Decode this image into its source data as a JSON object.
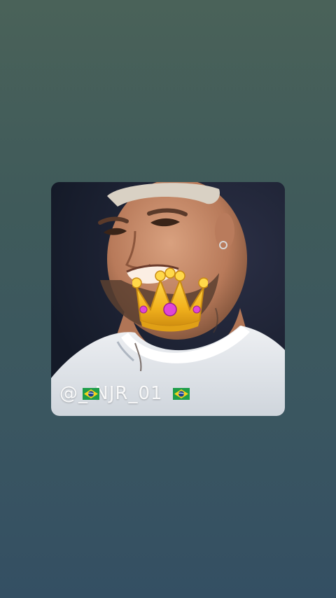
{
  "screen": {
    "background_top": "#4a6259",
    "background_bottom": "#344f63"
  },
  "media": {
    "subject": "smiling-player-photo",
    "overlay_icon": "crown-emoji",
    "watermark": {
      "text": "@_ NJR_01",
      "icon": "brazil-flag-icon"
    }
  }
}
